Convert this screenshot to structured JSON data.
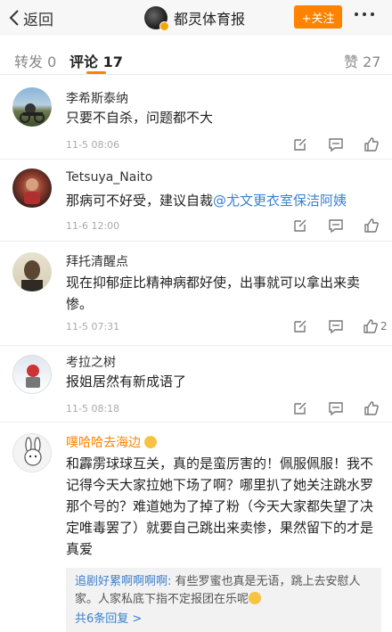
{
  "header": {
    "back_label": "返回",
    "title": "都灵体育报",
    "follow_label": "+关注"
  },
  "tabs": {
    "repost_label": "转发",
    "repost_count": "0",
    "comment_label": "评论",
    "comment_count": "17",
    "like_label": "赞",
    "like_count": "27"
  },
  "comments": [
    {
      "name": "李希斯泰纳",
      "text": "只要不自杀，问题都不大",
      "time": "11-5 08:06"
    },
    {
      "name": "Tetsuya_Naito",
      "text": "那病可不好受，建议自裁",
      "mention": "@尤文更衣室保洁阿姨",
      "time": "11-6 12:00"
    },
    {
      "name": "拜托清醒点",
      "text": "现在抑郁症比精神病都好使，出事就可以拿出来卖惨。",
      "time": "11-5 07:31",
      "like_count": "2"
    },
    {
      "name": "考拉之树",
      "text": "报姐居然有新成语了",
      "time": "11-5 08:18"
    },
    {
      "name": "噗哈哈去海边",
      "text": "和霹雳球球互关，真的是蛮厉害的！佩服佩服！我不记得今天大家拉她下场了啊？哪里扒了她关注跳水罗那个号的？难道她为了掉了粉（今天大家都失望了决定唯毒罢了）就要自己跳出来卖惨，果然留下的才是真爱"
    }
  ],
  "reply": {
    "author": "追剧好累啊啊啊啊:",
    "text": " 有些罗蜜也真是无语，跳上去安慰人家。人家私底下指不定报团在乐呢",
    "count_label": "共6条回复 >"
  }
}
